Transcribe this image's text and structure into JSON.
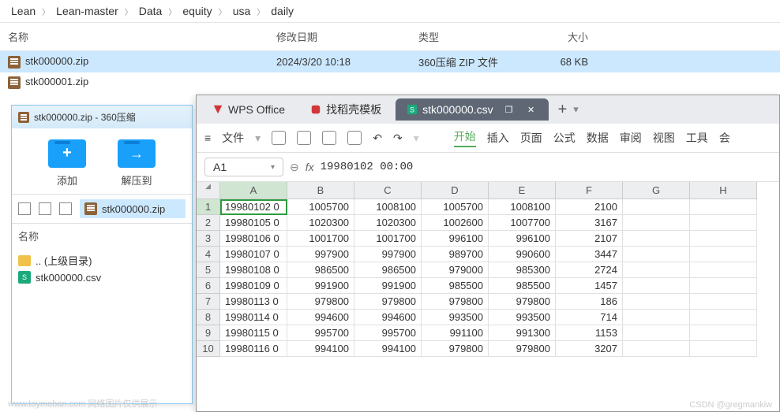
{
  "breadcrumb": [
    "Lean",
    "Lean-master",
    "Data",
    "equity",
    "usa",
    "daily"
  ],
  "explorer": {
    "headers": {
      "name": "名称",
      "date": "修改日期",
      "type": "类型",
      "size": "大小"
    },
    "rows": [
      {
        "name": "stk000000.zip",
        "date": "2024/3/20 10:18",
        "type": "360压缩 ZIP 文件",
        "size": "68 KB",
        "selected": true
      },
      {
        "name": "stk000001.zip",
        "date": "",
        "type": "",
        "size": "",
        "selected": false
      }
    ]
  },
  "archive": {
    "title": "stk000000.zip - 360压缩",
    "btn_add": "添加",
    "btn_extract": "解压到",
    "current_file": "stk000000.zip",
    "name_label": "名称",
    "updir": ".. (上级目录)",
    "items": [
      "stk000000.csv"
    ]
  },
  "wps": {
    "tab1": "WPS Office",
    "tab2": "找稻壳模板",
    "tab3": "stk000000.csv",
    "menu_file": "文件",
    "menus": [
      "开始",
      "插入",
      "页面",
      "公式",
      "数据",
      "审阅",
      "视图",
      "工具",
      "会"
    ],
    "cell_ref": "A1",
    "formula": "19980102 00:00",
    "columns": [
      "A",
      "B",
      "C",
      "D",
      "E",
      "F",
      "G",
      "H"
    ],
    "chart_data": {
      "type": "table",
      "columns": [
        "A",
        "B",
        "C",
        "D",
        "E",
        "F"
      ],
      "rows": [
        [
          "19980102 0",
          1005700,
          1008100,
          1005700,
          1008100,
          2100
        ],
        [
          "19980105 0",
          1020300,
          1020300,
          1002600,
          1007700,
          3167
        ],
        [
          "19980106 0",
          1001700,
          1001700,
          996100,
          996100,
          2107
        ],
        [
          "19980107 0",
          997900,
          997900,
          989700,
          990600,
          3447
        ],
        [
          "19980108 0",
          986500,
          986500,
          979000,
          985300,
          2724
        ],
        [
          "19980109 0",
          991900,
          991900,
          985500,
          985500,
          1457
        ],
        [
          "19980113 0",
          979800,
          979800,
          979800,
          979800,
          186
        ],
        [
          "19980114 0",
          994600,
          994600,
          993500,
          993500,
          714
        ],
        [
          "19980115 0",
          995700,
          995700,
          991100,
          991300,
          1153
        ],
        [
          "19980116 0",
          994100,
          994100,
          979800,
          979800,
          3207
        ]
      ]
    }
  },
  "watermark1": "www.toymoban.com  网络图片仅供展示",
  "watermark2": "CSDN @gregmankiw"
}
